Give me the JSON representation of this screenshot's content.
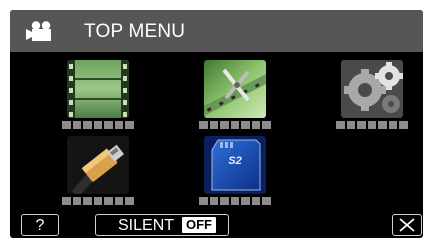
{
  "title": "TOP MENU",
  "menu_items": [
    {
      "icon": "film-strip-icon",
      "label": "■■■■■■■"
    },
    {
      "icon": "edit-scissors-icon",
      "label": "■■■■■■■"
    },
    {
      "icon": "settings-gears-icon",
      "label": "■■■■■■■"
    },
    {
      "icon": "hdmi-cable-icon",
      "label": "■■■■■■■"
    },
    {
      "icon": "sd-card-icon",
      "label": "■■■■■■■"
    }
  ],
  "help_button": {
    "label": "?"
  },
  "silent_button": {
    "label": "SILENT",
    "state": "OFF"
  },
  "close_button": {
    "icon": "close-icon"
  },
  "colors": {
    "title_bar": "#565656",
    "background": "#000000",
    "label_dots": "#8c8c8c",
    "button_border": "#cfcfcf"
  }
}
